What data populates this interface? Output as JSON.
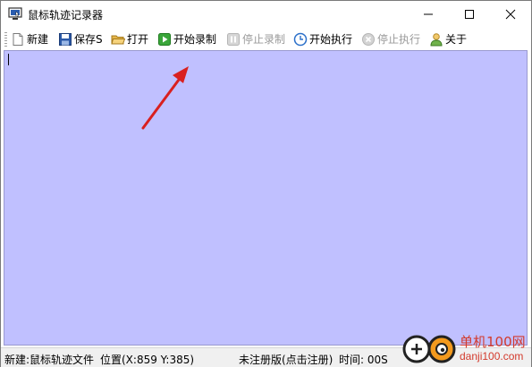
{
  "window": {
    "title": "鼠标轨迹记录器"
  },
  "toolbar": {
    "items": [
      {
        "label": "新建",
        "icon": "new-file-icon",
        "enabled": true
      },
      {
        "label": "保存S",
        "icon": "save-icon",
        "enabled": true
      },
      {
        "label": "打开",
        "icon": "open-folder-icon",
        "enabled": true
      },
      {
        "label": "开始录制",
        "icon": "record-play-icon",
        "enabled": true
      },
      {
        "label": "停止录制",
        "icon": "pause-icon",
        "enabled": false
      },
      {
        "label": "开始执行",
        "icon": "clock-icon",
        "enabled": true
      },
      {
        "label": "停止执行",
        "icon": "stop-icon",
        "enabled": false
      },
      {
        "label": "关于",
        "icon": "user-icon",
        "enabled": true
      }
    ]
  },
  "editor": {
    "background": "#c0c0ff"
  },
  "statusbar": {
    "file": "新建:鼠标轨迹文件",
    "position": "位置(X:859 Y:385)",
    "registration": "未注册版(点击注册)",
    "time": "时间:  00S"
  },
  "watermark": {
    "text": "单机100网",
    "url": "danji100.com"
  },
  "colors": {
    "accent_red": "#d9201f",
    "disabled_text": "#9a9a9a"
  }
}
